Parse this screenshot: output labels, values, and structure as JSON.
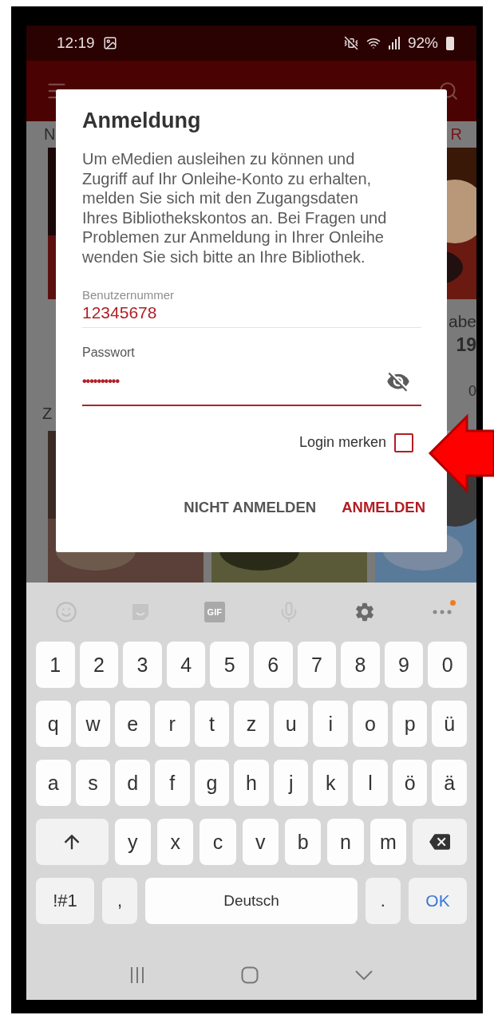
{
  "status_bar": {
    "time": "12:19",
    "battery": "92%"
  },
  "background": {
    "tabs": [
      "N",
      "R"
    ],
    "shelf_1": {
      "covers": [
        {
          "kind": "picture"
        },
        {
          "kind": "picture"
        }
      ],
      "captions": [
        "abe",
        "19",
        "0"
      ]
    },
    "heading": "Z",
    "shelf_2": {
      "covers": [
        {
          "kind": "picture"
        },
        {
          "kind": "picture"
        },
        {
          "kind": "picture"
        }
      ]
    }
  },
  "dialog": {
    "title": "Anmeldung",
    "message": "Um eMedien ausleihen zu können und Zugriff auf Ihr Onleihe-Konto zu erhalten, melden Sie sich mit den Zugangsdaten Ihres Bibliothekskontos an. Bei Fragen und Problemen zur Anmeldung in Ihrer Onleihe wenden Sie sich bitte an Ihre Bibliothek.",
    "fields": [
      {
        "label": "Benutzernummer",
        "value": "12345678",
        "kind": "text",
        "focused": false
      },
      {
        "label": "Passwort",
        "value": "••••••••••",
        "kind": "password",
        "focused": true
      }
    ],
    "remember": {
      "label": "Login merken",
      "checked": false
    },
    "buttons": [
      {
        "label": "NICHT ANMELDEN",
        "kind": "secondary"
      },
      {
        "label": "ANMELDEN",
        "kind": "primary"
      }
    ]
  },
  "keyboard": {
    "gif_label": "GIF",
    "more_badge": true,
    "rows": [
      {
        "kind": "plain",
        "keys": [
          "1",
          "2",
          "3",
          "4",
          "5",
          "6",
          "7",
          "8",
          "9",
          "0"
        ]
      },
      {
        "kind": "plain",
        "keys": [
          "q",
          "w",
          "e",
          "r",
          "t",
          "z",
          "u",
          "i",
          "o",
          "p",
          "ü"
        ]
      },
      {
        "kind": "plain",
        "keys": [
          "a",
          "s",
          "d",
          "f",
          "g",
          "h",
          "j",
          "k",
          "l",
          "ö",
          "ä"
        ]
      },
      {
        "kind": "shift",
        "keys": [
          "y",
          "x",
          "c",
          "v",
          "b",
          "n",
          "m"
        ]
      }
    ],
    "bottom_row": [
      {
        "label": "!#1",
        "kind": "function"
      },
      {
        "label": ",",
        "kind": "char"
      },
      {
        "label": "Deutsch",
        "kind": "space"
      },
      {
        "label": ".",
        "kind": "char"
      },
      {
        "label": "OK",
        "kind": "action"
      }
    ]
  }
}
